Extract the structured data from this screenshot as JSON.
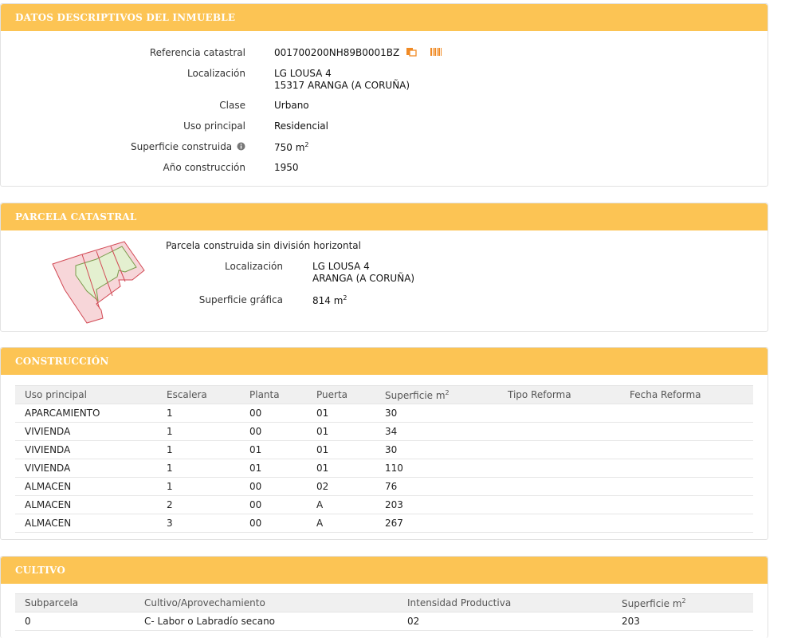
{
  "descriptivos": {
    "title": "DATOS DESCRIPTIVOS DEL INMUEBLE",
    "ref_label": "Referencia catastral",
    "ref_value": "001700200NH89B0001BZ",
    "loc_label": "Localización",
    "loc_line1": "LG LOUSA 4",
    "loc_line2": "15317 ARANGA (A CORUÑA)",
    "clase_label": "Clase",
    "clase_value": "Urbano",
    "uso_label": "Uso principal",
    "uso_value": "Residencial",
    "sup_label": "Superficie construida",
    "sup_value": "750 m",
    "sup_exp": "2",
    "anio_label": "Año construcción",
    "anio_value": "1950"
  },
  "parcela": {
    "title": "PARCELA CATASTRAL",
    "heading": "Parcela construida sin división horizontal",
    "loc_label": "Localización",
    "loc_line1": "LG LOUSA 4",
    "loc_line2": "ARANGA (A CORUÑA)",
    "sup_label": "Superficie gráfica",
    "sup_value": "814 m",
    "sup_exp": "2"
  },
  "construccion": {
    "title": "CONSTRUCCIÓN",
    "headers": [
      "Uso principal",
      "Escalera",
      "Planta",
      "Puerta",
      "Superficie m",
      "Tipo Reforma",
      "Fecha Reforma"
    ],
    "rows": [
      [
        "APARCAMIENTO",
        "1",
        "00",
        "01",
        "30",
        "",
        ""
      ],
      [
        "VIVIENDA",
        "1",
        "00",
        "01",
        "34",
        "",
        ""
      ],
      [
        "VIVIENDA",
        "1",
        "01",
        "01",
        "30",
        "",
        ""
      ],
      [
        "VIVIENDA",
        "1",
        "01",
        "01",
        "110",
        "",
        ""
      ],
      [
        "ALMACEN",
        "1",
        "00",
        "02",
        "76",
        "",
        ""
      ],
      [
        "ALMACEN",
        "2",
        "00",
        "A",
        "203",
        "",
        ""
      ],
      [
        "ALMACEN",
        "3",
        "00",
        "A",
        "267",
        "",
        ""
      ]
    ]
  },
  "cultivo": {
    "title": "CULTIVO",
    "headers": [
      "Subparcela",
      "Cultivo/Aprovechamiento",
      "Intensidad Productiva",
      "Superficie m"
    ],
    "rows": [
      [
        "0",
        "C- Labor o Labradío secano",
        "02",
        "203"
      ]
    ]
  },
  "sup_exp": "2",
  "icons": {
    "copy": "copy-icon",
    "barcode": "barcode-icon",
    "info": "info-icon",
    "accent": "#fcc454",
    "icon_orange": "#f08a24"
  }
}
